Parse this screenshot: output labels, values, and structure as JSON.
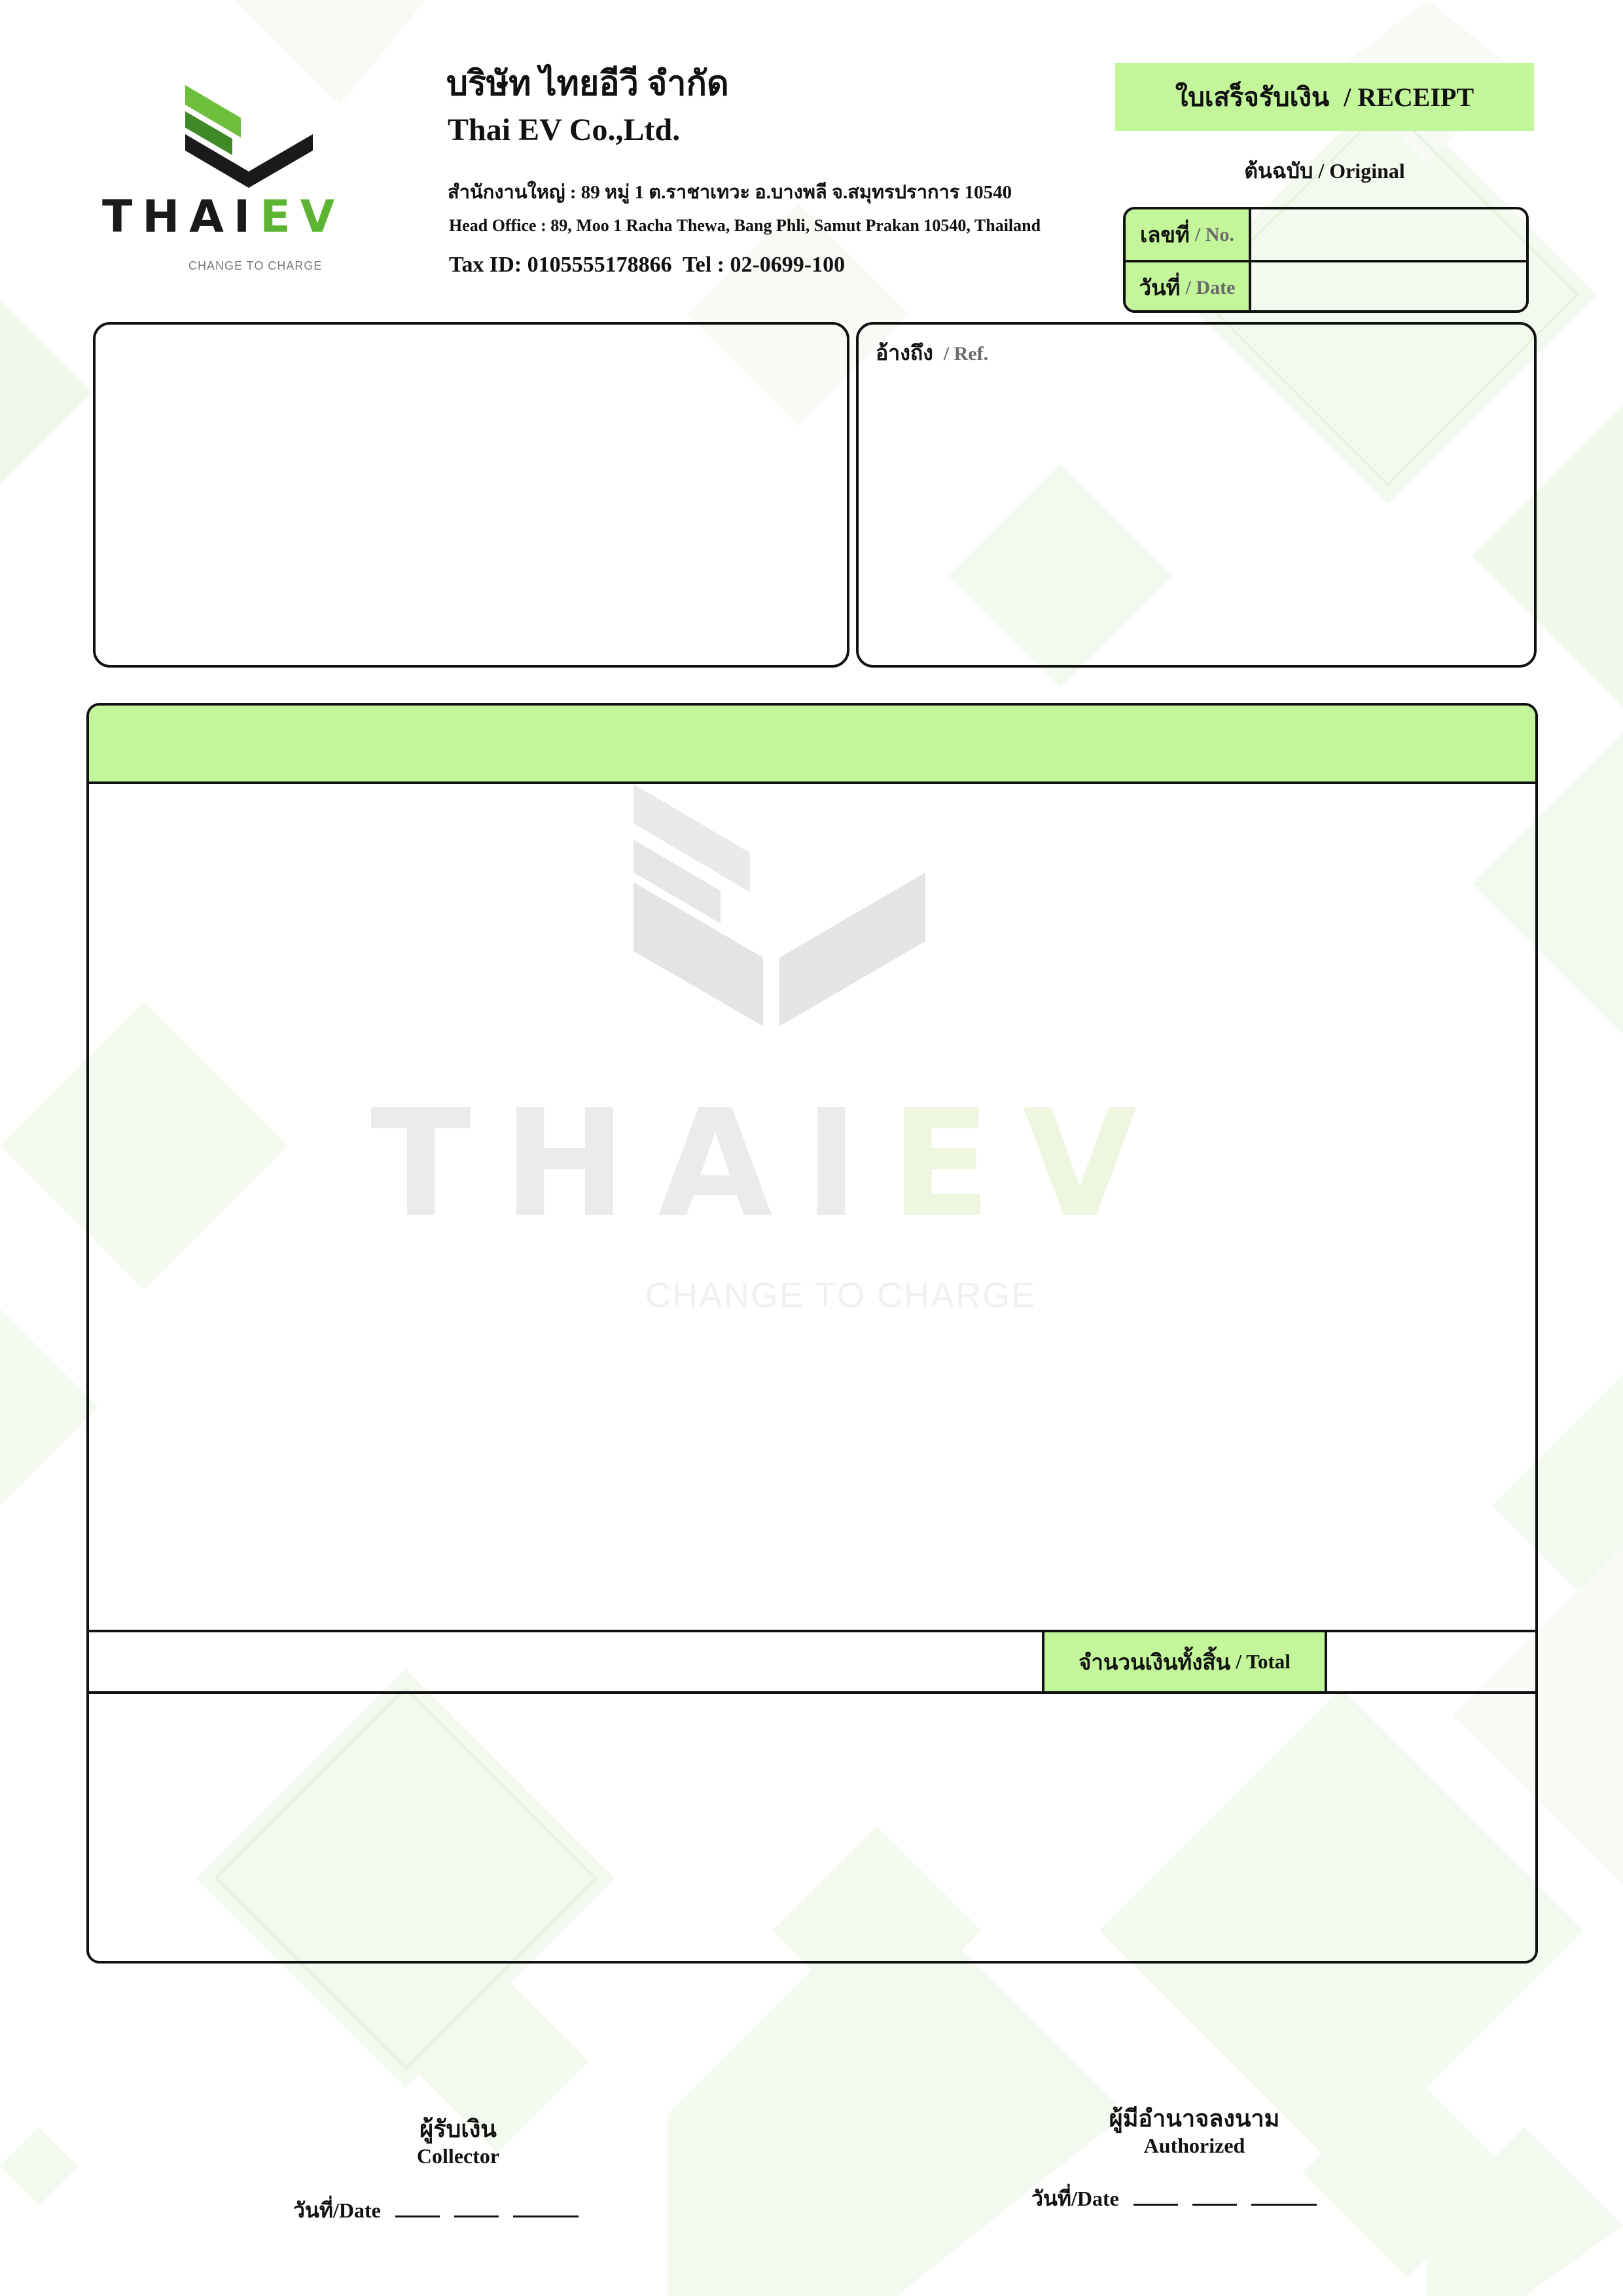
{
  "colors": {
    "accent": "#c3f59a",
    "brand_dark": "#1a1a1a",
    "brand_green": "#5cb532",
    "watermark": "#ebebeb",
    "watermark_green": "#eef6df"
  },
  "logo": {
    "word_dark": "THAI",
    "word_green": "EV",
    "tagline": "CHANGE TO CHARGE"
  },
  "company": {
    "name_th": "บริษัท ไทยอีวี จำกัด",
    "name_en": "Thai EV Co.,Ltd.",
    "address_th": "สำนักงานใหญ่ : 89 หมู่ 1 ต.ราชาเทวะ อ.บางพลี จ.สมุทรปราการ 10540",
    "address_en": "Head Office : 89, Moo 1 Racha Thewa, Bang Phli, Samut Prakan 10540, Thailand",
    "tax_tel": "Tax ID: 0105555178866  Tel : 02-0699-100"
  },
  "doc": {
    "title_th": "ใบเสร็จรับเงิน",
    "title_en": "/ RECEIPT",
    "copy_th": "ต้นฉบับ",
    "copy_en": "/ Original",
    "no_th": "เลขที่",
    "no_en": "/ No.",
    "no_value": "",
    "date_th": "วันที่",
    "date_en": "/ Date",
    "date_value": ""
  },
  "ref": {
    "label_th": "อ้างถึง",
    "label_en": "/ Ref."
  },
  "total": {
    "label_th": "จำนวนเงินทั้งสิ้น",
    "label_en": "/ Total",
    "value": ""
  },
  "signatures": {
    "collector_th": "ผู้รับเงิน",
    "collector_en": "Collector",
    "authorized_th": "ผู้มีอำนาจลงนาม",
    "authorized_en": "Authorized",
    "date_label": "วันที่/Date"
  }
}
